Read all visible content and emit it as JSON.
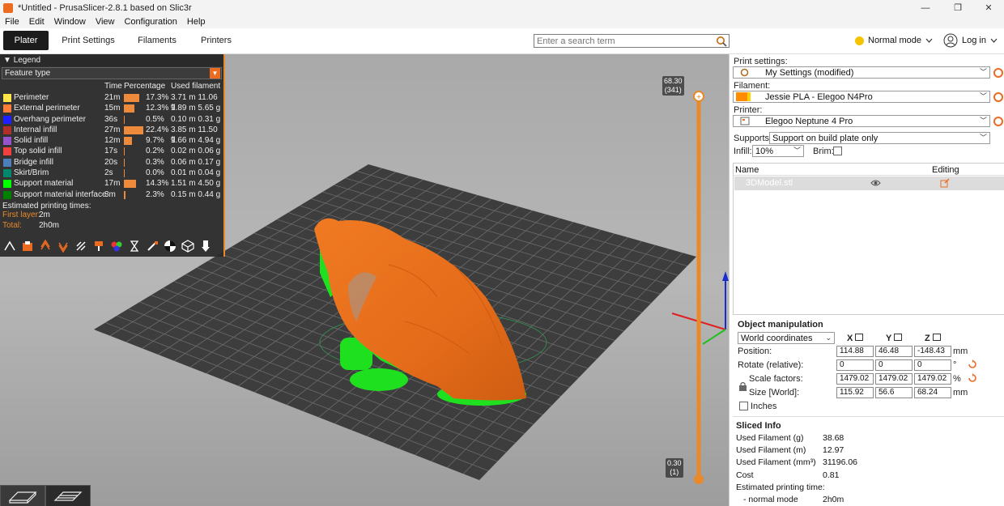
{
  "window": {
    "title": "*Untitled - PrusaSlicer-2.8.1 based on Slic3r",
    "controls": [
      "—",
      "❐",
      "✕"
    ]
  },
  "menu": [
    "File",
    "Edit",
    "Window",
    "View",
    "Configuration",
    "Help"
  ],
  "tabs": [
    {
      "label": "Plater",
      "active": true
    },
    {
      "label": "Print Settings",
      "active": false
    },
    {
      "label": "Filaments",
      "active": false
    },
    {
      "label": "Printers",
      "active": false
    }
  ],
  "search": {
    "placeholder": "Enter a search term",
    "icon": "search-icon"
  },
  "mode": {
    "label": "Normal mode",
    "color": "#f4c400"
  },
  "account": {
    "label": "Log in",
    "icon": "user-icon"
  },
  "legend": {
    "title": "Legend",
    "view_type": "Feature type",
    "columns": {
      "time": "Time",
      "percentage": "Percentage",
      "filament": "Used filament"
    },
    "rows": [
      {
        "name": "Perimeter",
        "color": "#ffe54a",
        "time": "21m",
        "percent": "17.3%",
        "pct_value": 17.3,
        "filament": "3.71 m  11.06 g"
      },
      {
        "name": "External perimeter",
        "color": "#ff7d38",
        "time": "15m",
        "percent": "12.3%",
        "pct_value": 12.3,
        "filament": "1.89 m  5.65 g"
      },
      {
        "name": "Overhang perimeter",
        "color": "#1f1fff",
        "time": "36s",
        "percent": "0.5%",
        "pct_value": 0.5,
        "filament": "0.10 m  0.31 g"
      },
      {
        "name": "Internal infill",
        "color": "#b03029",
        "time": "27m",
        "percent": "22.4%",
        "pct_value": 22.4,
        "filament": "3.85 m  11.50 g"
      },
      {
        "name": "Solid infill",
        "color": "#9654cc",
        "time": "12m",
        "percent": "9.7%",
        "pct_value": 9.7,
        "filament": "1.66 m  4.94 g"
      },
      {
        "name": "Top solid infill",
        "color": "#f04040",
        "time": "17s",
        "percent": "0.2%",
        "pct_value": 0.2,
        "filament": "0.02 m  0.06 g"
      },
      {
        "name": "Bridge infill",
        "color": "#4d80ba",
        "time": "20s",
        "percent": "0.3%",
        "pct_value": 0.3,
        "filament": "0.06 m  0.17 g"
      },
      {
        "name": "Skirt/Brim",
        "color": "#00876e",
        "time": "2s",
        "percent": "0.0%",
        "pct_value": 0.0,
        "filament": "0.01 m  0.04 g"
      },
      {
        "name": "Support material",
        "color": "#00ff00",
        "time": "17m",
        "percent": "14.3%",
        "pct_value": 14.3,
        "filament": "1.51 m  4.50 g"
      },
      {
        "name": "Support material interface",
        "color": "#008000",
        "time": "3m",
        "percent": "2.3%",
        "pct_value": 2.3,
        "filament": "0.15 m  0.44 g"
      }
    ],
    "estimated_label": "Estimated printing times:",
    "first_layer": {
      "label": "First layer:",
      "value": "2m"
    },
    "total": {
      "label": "Total:",
      "value": "2h0m"
    }
  },
  "layer_slider": {
    "top": {
      "height": "68.30",
      "layer": "(341)"
    },
    "bottom": {
      "height": "0.30",
      "layer": "(1)"
    }
  },
  "sidebar": {
    "print_settings": {
      "label": "Print settings:",
      "value": "My Settings (modified)"
    },
    "filament": {
      "label": "Filament:",
      "value": "Jessie PLA - Elegoo N4Pro",
      "color": "#ff8c00"
    },
    "printer": {
      "label": "Printer:",
      "value": "Elegoo Neptune 4 Pro"
    },
    "supports": {
      "label": "Supports:",
      "value": "Support on build plate only"
    },
    "infill": {
      "label": "Infill:",
      "value": "10%"
    },
    "brim": {
      "label": "Brim:"
    },
    "object_list": {
      "col_name": "Name",
      "col_editing": "Editing",
      "objects": [
        {
          "name": "3DModel.stl"
        }
      ]
    },
    "object_manipulation": {
      "title": "Object manipulation",
      "coord_system": "World coordinates",
      "axes": [
        "X",
        "Y",
        "Z"
      ],
      "rows": [
        {
          "label": "Position:",
          "x": "114.88",
          "y": "46.48",
          "z": "-148.43",
          "unit": "mm"
        },
        {
          "label": "Rotate (relative):",
          "x": "0",
          "y": "0",
          "z": "0",
          "unit": "°"
        },
        {
          "label": "Scale factors:",
          "x": "1479.02",
          "y": "1479.02",
          "z": "1479.02",
          "unit": "%"
        },
        {
          "label": "Size [World]:",
          "x": "115.92",
          "y": "56.6",
          "z": "68.24",
          "unit": "mm"
        }
      ],
      "inches_label": "Inches"
    },
    "sliced_info": {
      "title": "Sliced Info",
      "rows": [
        {
          "label": "Used Filament (g)",
          "value": "38.68"
        },
        {
          "label": "Used Filament (m)",
          "value": "12.97"
        },
        {
          "label": "Used Filament (mm³)",
          "value": "31196.06"
        },
        {
          "label": "Cost",
          "value": "0.81"
        },
        {
          "label": "Estimated printing time:",
          "value": ""
        },
        {
          "label": "- normal mode",
          "value": "2h0m"
        }
      ]
    }
  }
}
